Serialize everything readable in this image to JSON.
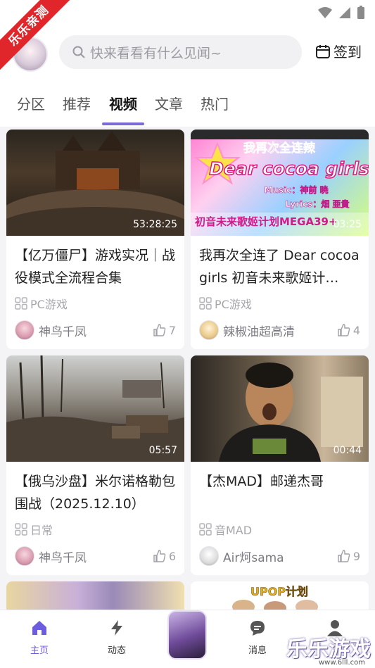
{
  "status_bar": {
    "wifi_icon": "wifi-icon",
    "signal_icon": "signal-icon",
    "battery_icon": "battery-icon"
  },
  "promo_ribbon": "乐乐亲测",
  "search": {
    "placeholder": "快来看看有什么见闻~"
  },
  "signin_label": "签到",
  "tabs": [
    {
      "label": "分区",
      "active": false
    },
    {
      "label": "推荐",
      "active": false
    },
    {
      "label": "视频",
      "active": true
    },
    {
      "label": "文章",
      "active": false
    },
    {
      "label": "热门",
      "active": false
    }
  ],
  "accent_color": "#7b6bd6",
  "cards": [
    {
      "title": "【亿万僵尸】游戏实况｜战役模式全流程合集",
      "duration": "53:28:25",
      "category": "PC游戏",
      "user": "神鸟千凤",
      "likes": "7"
    },
    {
      "title": "我再次全连了 Dear cocoa girls 初音未来歌姬计…",
      "duration": "03:25",
      "category": "PC游戏",
      "user": "辣椒油超高清",
      "likes": "4"
    },
    {
      "title": "【俄乌沙盘】米尔诺格勒包围战（2025.12.10）",
      "duration": "05:57",
      "category": "日常",
      "user": "神鸟千凤",
      "likes": "6"
    },
    {
      "title": "【杰MAD】邮递杰哥",
      "duration": "00:44",
      "category": "音MAD",
      "user": "Air炣sama",
      "likes": "9"
    }
  ],
  "thumb2_text": {
    "line1": "我再次全连辣",
    "line2": "Dear cocoa girls",
    "line3": "Music：神前 暁",
    "line4": "Lyrics：畑 亜貴",
    "line5": "初音未来歌姬计划MEGA39+"
  },
  "thumb6_text": "UPOP计划",
  "bottom_nav": [
    {
      "label": "主页",
      "icon": "home-icon",
      "active": true
    },
    {
      "label": "动态",
      "icon": "lightning-icon",
      "active": false
    },
    {
      "label": "消息",
      "icon": "chat-icon",
      "active": false
    },
    {
      "label": "我的",
      "icon": "user-icon",
      "active": false
    }
  ],
  "watermark": {
    "text": "乐乐游戏",
    "url": "www.6lll.com"
  }
}
